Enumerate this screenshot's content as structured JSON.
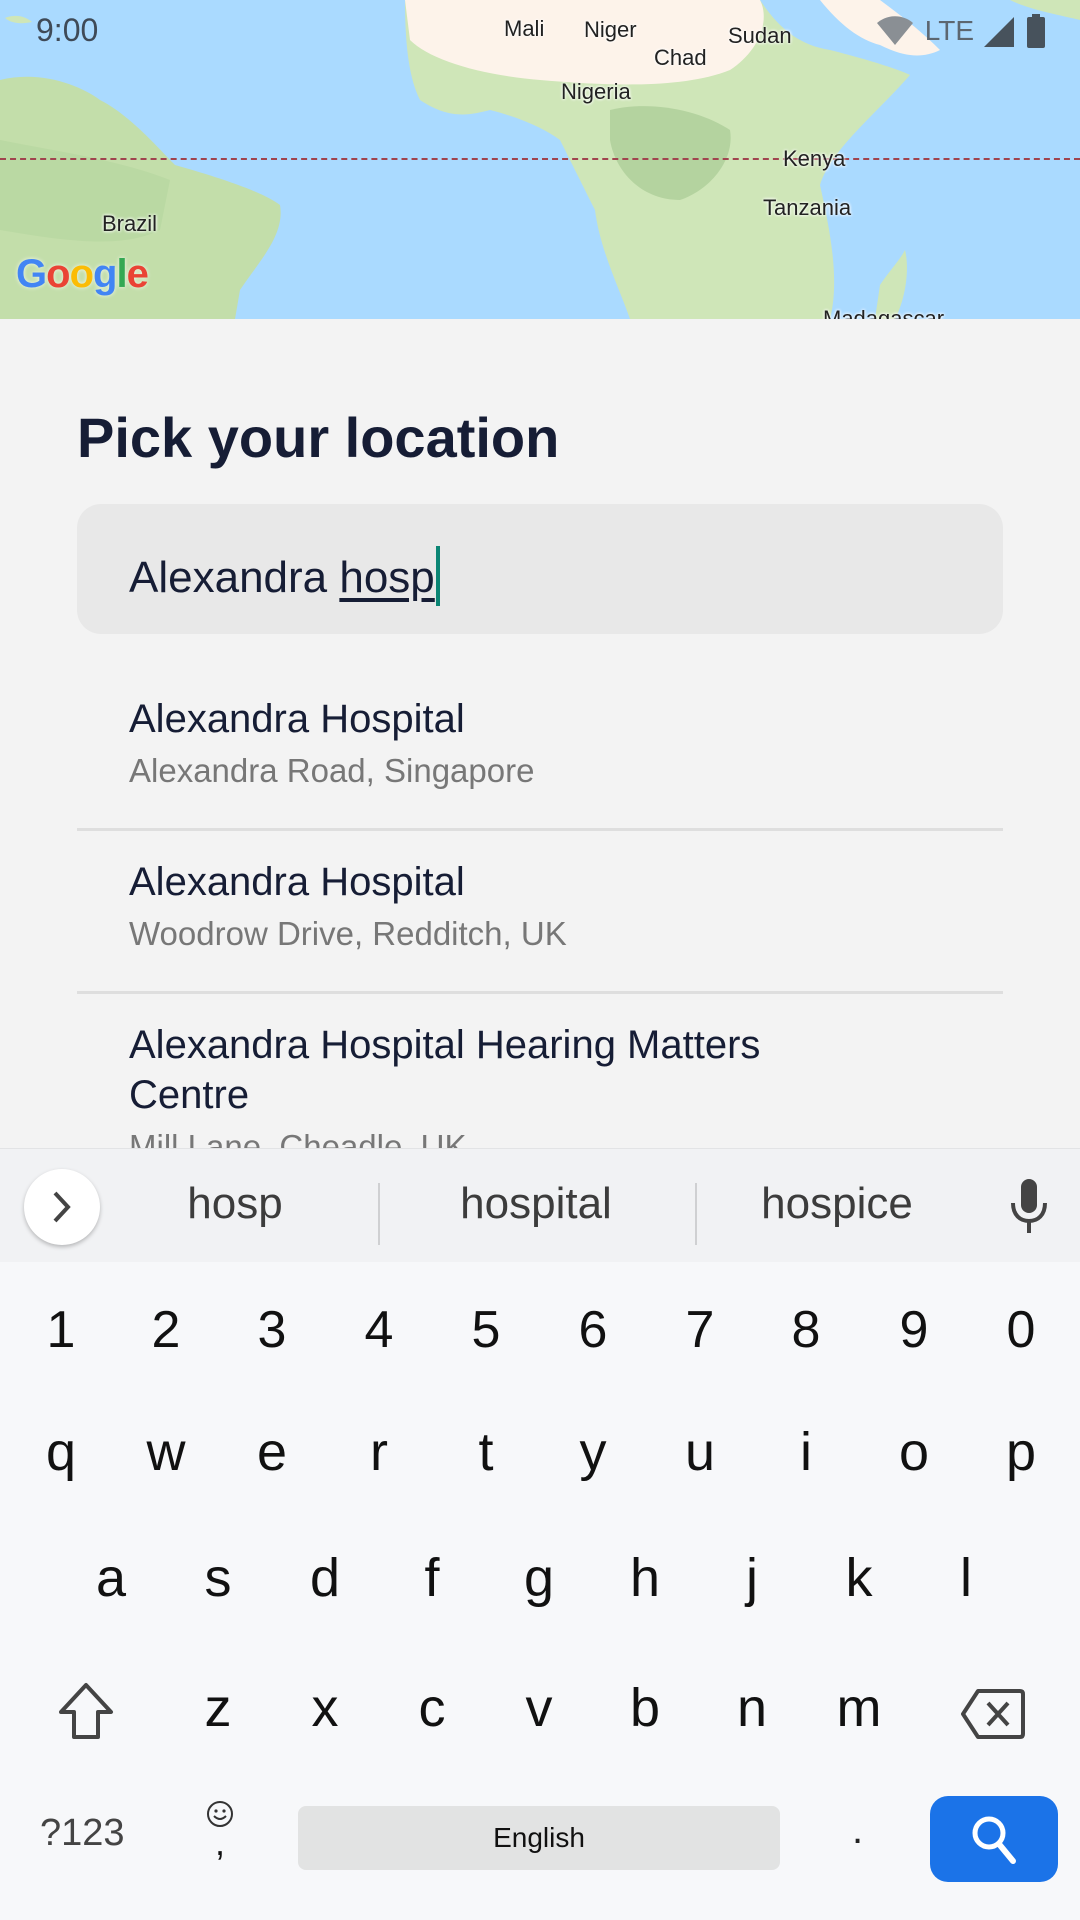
{
  "status_bar": {
    "time": "9:00",
    "network": "LTE",
    "icons": [
      "wifi-icon",
      "signal-icon",
      "battery-icon"
    ]
  },
  "map": {
    "labels": [
      "Mali",
      "Niger",
      "Sudan",
      "Chad",
      "Nigeria",
      "Kenya",
      "Tanzania",
      "Brazil",
      "Madagascar"
    ],
    "logo": "Google",
    "colors": {
      "water": "#aadaff",
      "land": "#c9e3b3",
      "desert": "#fdf3ea",
      "equator": "#a0444e"
    }
  },
  "page": {
    "title": "Pick your location"
  },
  "search": {
    "value_committed": "Alexandra ",
    "value_composing": "hosp",
    "caret_color": "#0b8574"
  },
  "results": [
    {
      "title": "Alexandra Hospital",
      "subtitle": "Alexandra Road, Singapore"
    },
    {
      "title": "Alexandra Hospital",
      "subtitle": "Woodrow Drive, Redditch, UK"
    },
    {
      "title": "Alexandra Hospital Hearing Matters Centre",
      "subtitle": "Mill Lane, Cheadle, UK"
    }
  ],
  "keyboard": {
    "suggestions": [
      "hosp",
      "hospital",
      "hospice"
    ],
    "row_numbers": [
      "1",
      "2",
      "3",
      "4",
      "5",
      "6",
      "7",
      "8",
      "9",
      "0"
    ],
    "row1": [
      "q",
      "w",
      "e",
      "r",
      "t",
      "y",
      "u",
      "i",
      "o",
      "p"
    ],
    "row2": [
      "a",
      "s",
      "d",
      "f",
      "g",
      "h",
      "j",
      "k",
      "l"
    ],
    "row3": [
      "z",
      "x",
      "c",
      "v",
      "b",
      "n",
      "m"
    ],
    "symbols_label": "?123",
    "comma_label": ",",
    "space_label": "English",
    "period_label": ".",
    "action_color": "#1b73e8"
  }
}
